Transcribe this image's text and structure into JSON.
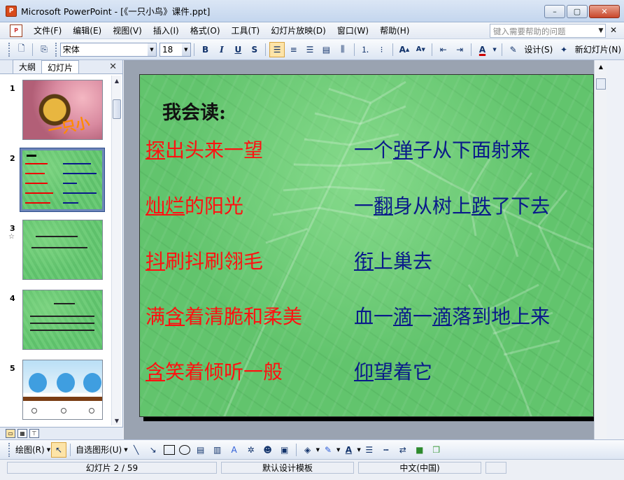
{
  "window": {
    "title": "Microsoft PowerPoint - [《一只小鸟》课件.ppt]",
    "app_icon": "P"
  },
  "menubar": {
    "items": [
      "文件(F)",
      "编辑(E)",
      "视图(V)",
      "插入(I)",
      "格式(O)",
      "工具(T)",
      "幻灯片放映(D)",
      "窗口(W)",
      "帮助(H)"
    ],
    "help_placeholder": "键入需要帮助的问题"
  },
  "toolbar": {
    "font_name": "宋体",
    "font_size": "18",
    "bold": "B",
    "italic": "I",
    "underline": "U",
    "shadow": "S",
    "design_label": "设计(S)",
    "new_slide_label": "新幻灯片(N)"
  },
  "outline_panel": {
    "tabs": [
      "大纲",
      "幻灯片"
    ],
    "selected_tab": "幻灯片",
    "thumbnails": [
      {
        "number": "1",
        "kind": "bird-photo"
      },
      {
        "number": "2",
        "kind": "green",
        "selected": true
      },
      {
        "number": "3",
        "kind": "green"
      },
      {
        "number": "4",
        "kind": "green"
      },
      {
        "number": "5",
        "kind": "blue-birds"
      }
    ]
  },
  "slide": {
    "title": "我会读:",
    "left_phrases": [
      {
        "pre": "",
        "u": "探",
        "post": "出头来一望"
      },
      {
        "pre": "",
        "u": "灿烂",
        "post": "的阳光"
      },
      {
        "pre": "",
        "u": "抖",
        "post": "刷抖刷翎毛"
      },
      {
        "pre": "满",
        "u": "含",
        "post": "着清脆和柔美"
      },
      {
        "pre": "",
        "u": "含",
        "post": "笑着倾听一般"
      }
    ],
    "right_phrases": [
      {
        "pre": "一个",
        "u": "弹",
        "post": "子从下面射来"
      },
      {
        "pre": "一",
        "u": "翻",
        "post": "身从树上",
        "u2": "跌",
        "post2": "了下去"
      },
      {
        "pre": "",
        "u": "衔",
        "post": "上巢去"
      },
      {
        "pre": "血一",
        "u": "滴",
        "post": "一",
        "u2": "滴",
        "post2": "落到地上来"
      },
      {
        "pre": "",
        "u": "仰",
        "post": "望着它"
      }
    ],
    "colors": {
      "left": "#ff1111",
      "right": "#0a1a8a",
      "background": "#62c46d"
    }
  },
  "drawbar": {
    "draw_label": "绘图(R)",
    "autoshapes_label": "自选图形(U)"
  },
  "statusbar": {
    "slide_info": "幻灯片 2 / 59",
    "template": "默认设计模板",
    "language": "中文(中国)"
  }
}
